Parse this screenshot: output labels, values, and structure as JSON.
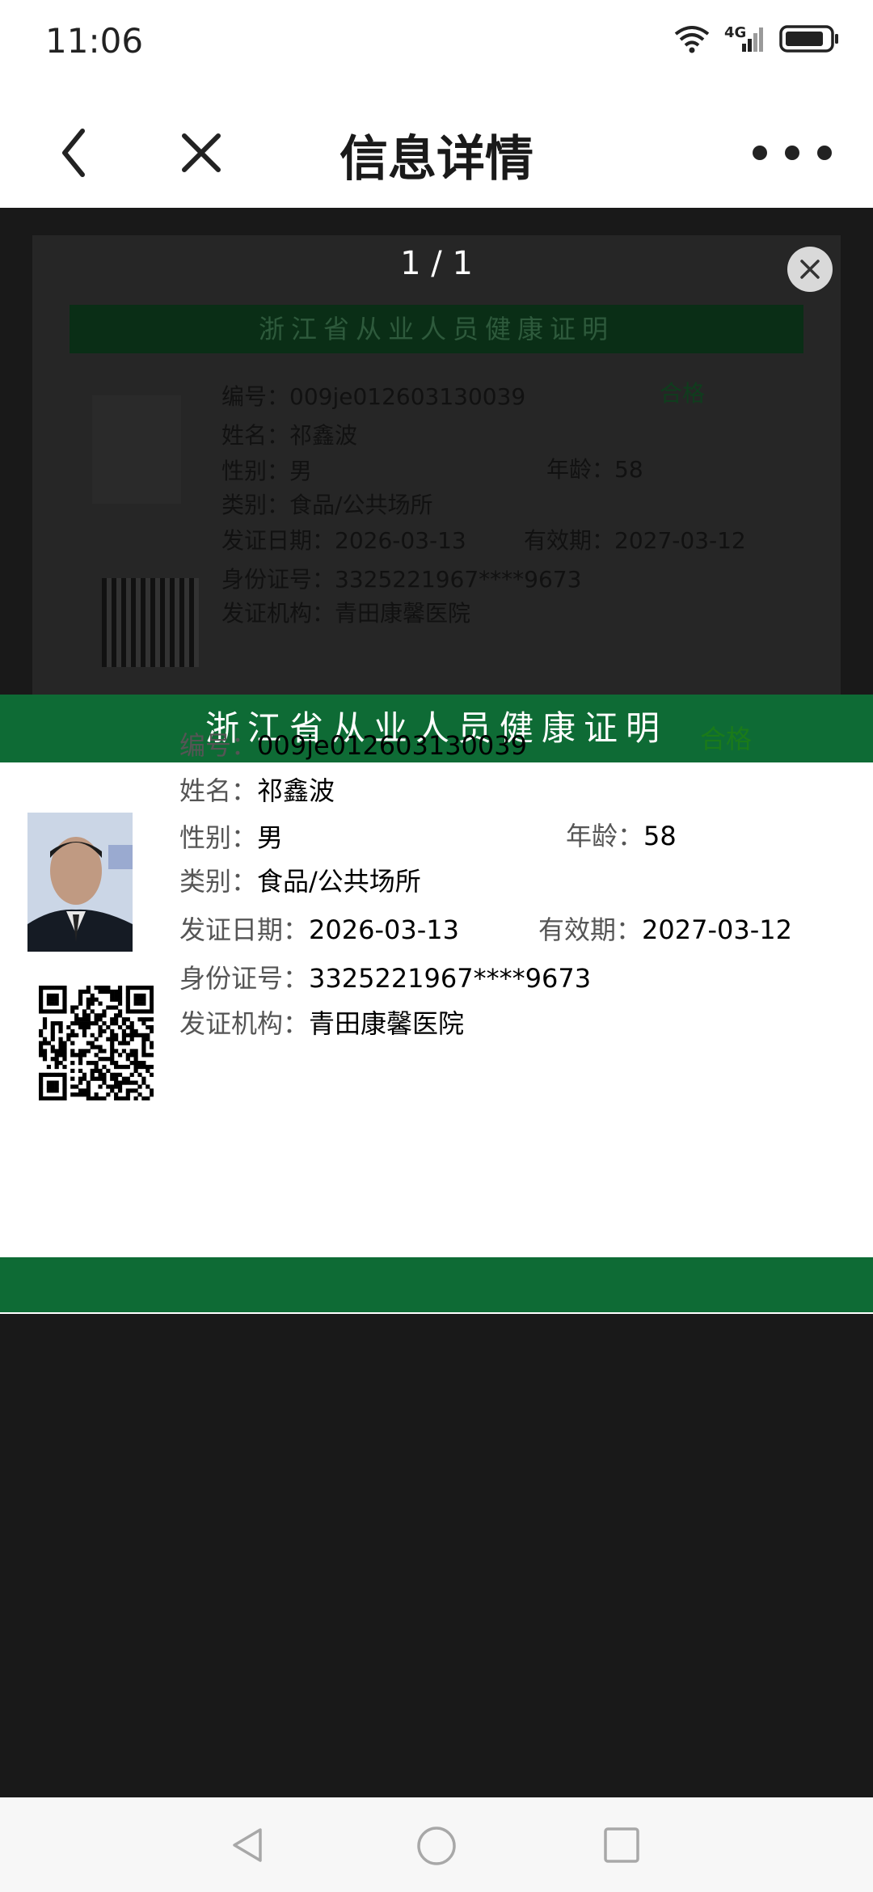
{
  "status_bar": {
    "time": "11:06",
    "network": "4G"
  },
  "nav": {
    "title": "信息详情"
  },
  "viewer": {
    "page_counter": "1 / 1"
  },
  "certificate": {
    "title": "浙江省从业人员健康证明",
    "status": "合格",
    "number_label": "编号：",
    "number": "009je012603130039",
    "name_label": "姓名：",
    "name": "祁鑫波",
    "gender_label": "性别：",
    "gender": "男",
    "age_label": "年龄：",
    "age": "58",
    "category_label": "类别：",
    "category": "食品/公共场所",
    "issue_date_label": "发证日期：",
    "issue_date": "2026-03-13",
    "valid_label": "有效期：",
    "valid_until": "2027-03-12",
    "id_label": "身份证号：",
    "id_number": "3325221967****9673",
    "issuer_label": "发证机构：",
    "issuer": "青田康馨医院"
  },
  "colors": {
    "brand_green": "#0e6b35",
    "status_green": "#1a7a1a"
  }
}
